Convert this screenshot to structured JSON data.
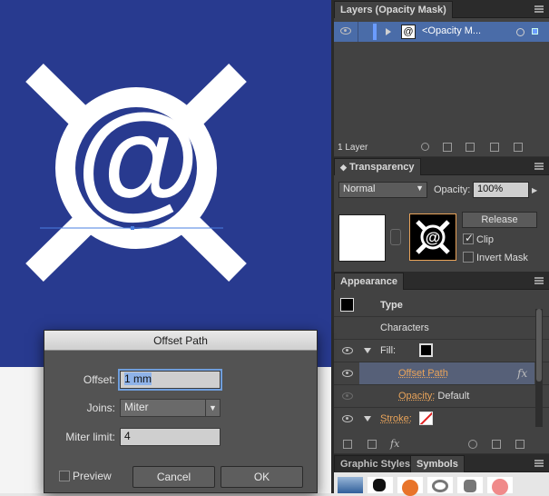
{
  "layers": {
    "tab": "Layers (Opacity Mask)",
    "row_name": "<Opacity M...",
    "footer": "1 Layer"
  },
  "transparency": {
    "tab": "Transparency",
    "blend_mode": "Normal",
    "opacity_label": "Opacity:",
    "opacity_value": "100%",
    "release_label": "Release",
    "clip_label": "Clip",
    "clip_checked": true,
    "invert_label": "Invert Mask",
    "invert_checked": false
  },
  "appearance": {
    "tab": "Appearance",
    "type_label": "Type",
    "characters_label": "Characters",
    "fill_label": "Fill:",
    "offset_path_label": "Offset Path",
    "fx_label": "fx",
    "opacity_label": "Opacity:",
    "opacity_value": "Default",
    "stroke_label": "Stroke:",
    "footer_fx": "fx"
  },
  "bottom_tabs": {
    "graphic_styles": "Graphic Styles",
    "symbols": "Symbols"
  },
  "dialog": {
    "title": "Offset Path",
    "offset_label": "Offset:",
    "offset_value": "1 mm",
    "joins_label": "Joins:",
    "joins_value": "Miter",
    "miter_label": "Miter limit:",
    "miter_value": "4",
    "preview_label": "Preview",
    "preview_checked": false,
    "cancel_label": "Cancel",
    "ok_label": "OK"
  },
  "colors": {
    "canvas_blue": "#283a8f",
    "panel_dark": "#323232",
    "accent_orange": "#e8a35a",
    "selection_blue": "#4a6ca8"
  },
  "icons": [
    "eye-icon",
    "target-icon",
    "search-icon",
    "new-layer-icon",
    "trash-icon",
    "fx-icon",
    "panel-menu-icon"
  ]
}
